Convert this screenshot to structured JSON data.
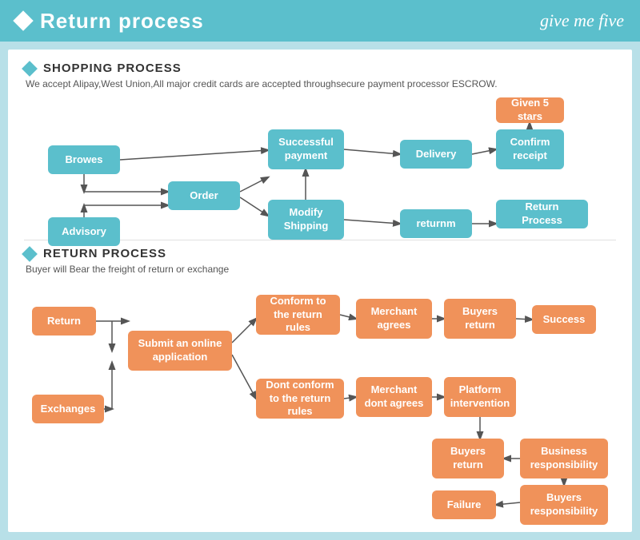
{
  "header": {
    "title": "Return process",
    "brand": "give me five",
    "diamond_label": "header-diamond"
  },
  "shopping_section": {
    "title": "SHOPPING PROCESS",
    "subtitle": "We accept Alipay,West Union,All major credit cards are accepted throughsecure payment processor ESCROW.",
    "boxes": {
      "browes": "Browes",
      "order": "Order",
      "advisory": "Advisory",
      "modify_shipping": "Modify Shipping",
      "successful_payment": "Successful payment",
      "delivery": "Delivery",
      "confirm_receipt": "Confirm receipt",
      "given_5_stars": "Given 5 stars",
      "returnm": "returnm",
      "return_process": "Return Process"
    }
  },
  "return_section": {
    "title": "RETURN PROCESS",
    "subtitle": "Buyer will Bear the freight of return or exchange",
    "boxes": {
      "return": "Return",
      "submit_online": "Submit an online application",
      "exchanges": "Exchanges",
      "conform_rules": "Conform to the return rules",
      "dont_conform": "Dont conform to the return rules",
      "merchant_agrees": "Merchant agrees",
      "merchant_dont": "Merchant dont agrees",
      "buyers_return1": "Buyers return",
      "platform": "Platform intervention",
      "success": "Success",
      "buyers_return2": "Buyers return",
      "business_resp": "Business responsibility",
      "failure": "Failure",
      "buyers_resp": "Buyers responsibility"
    }
  }
}
